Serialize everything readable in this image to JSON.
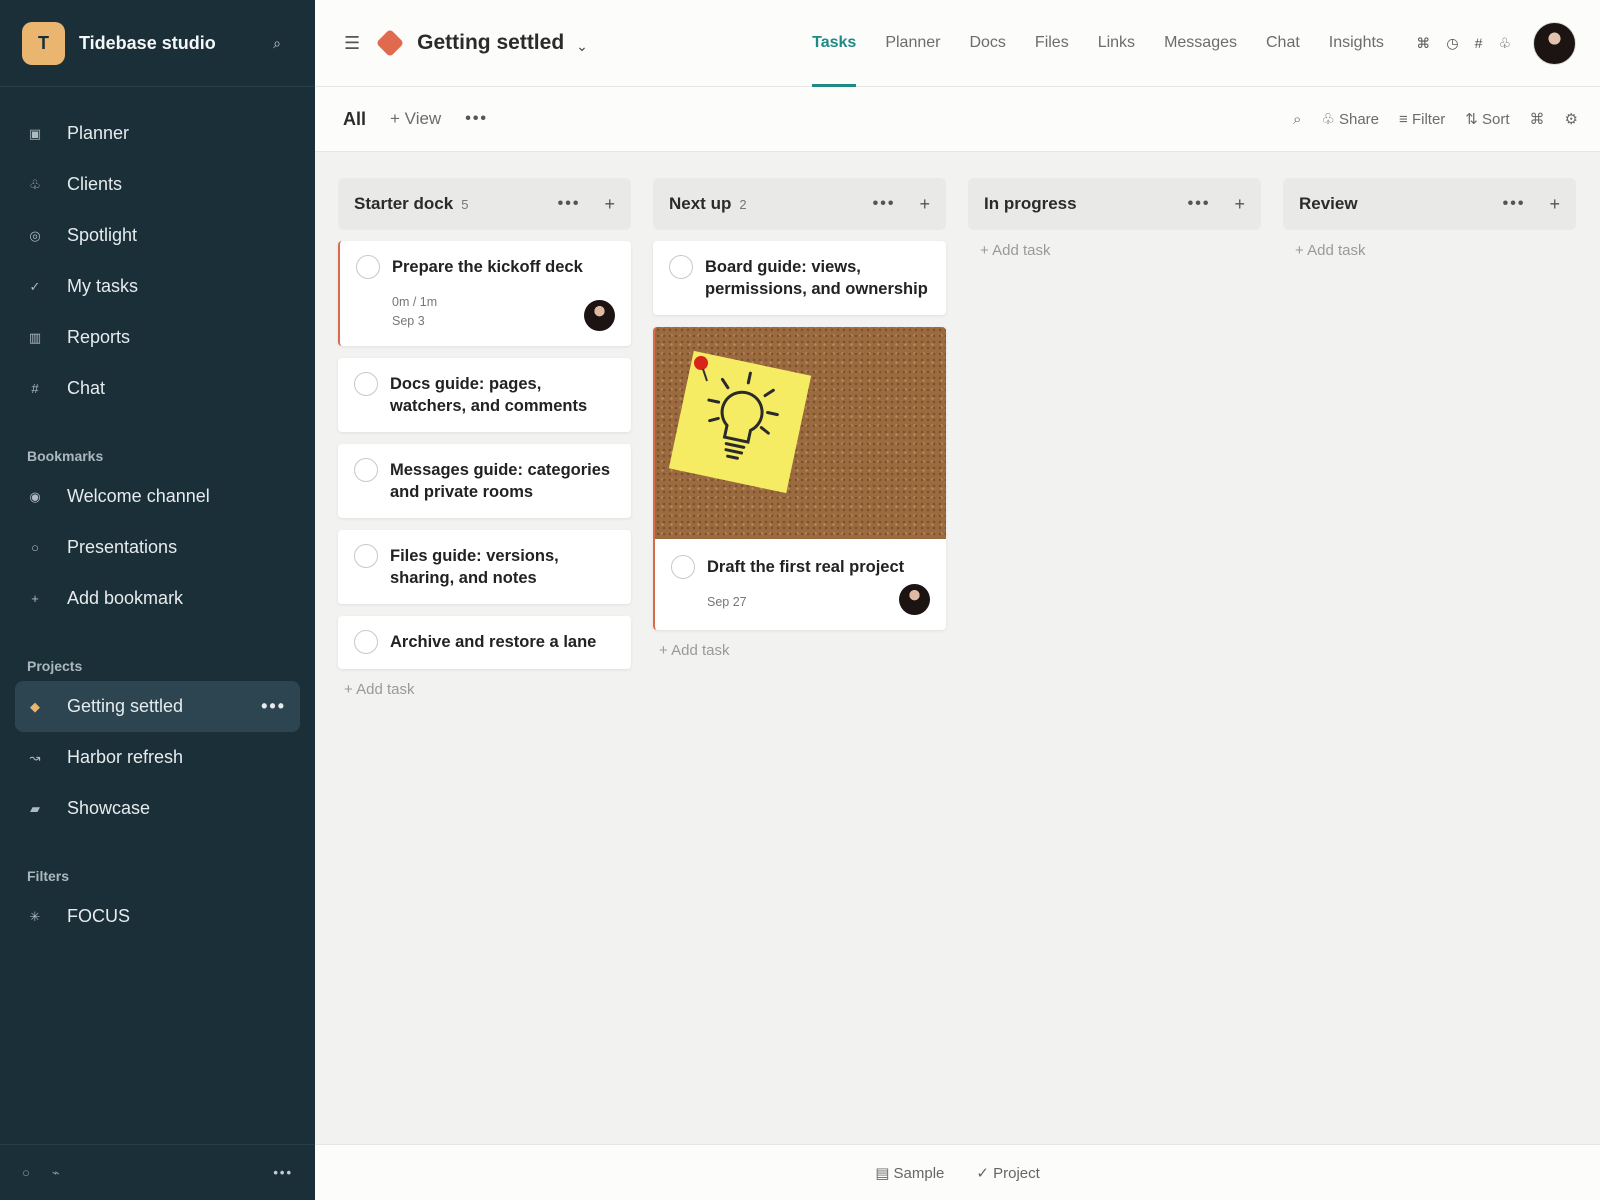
{
  "workspace": {
    "initial": "T",
    "name": "Tidebase studio"
  },
  "sidebar": {
    "nav": [
      {
        "label": "Planner",
        "icon": "planner-icon",
        "glyph": "▣"
      },
      {
        "label": "Clients",
        "icon": "clients-icon",
        "glyph": "♧"
      },
      {
        "label": "Spotlight",
        "icon": "spotlight-icon",
        "glyph": "◎"
      },
      {
        "label": "My tasks",
        "icon": "check-icon",
        "glyph": "✓"
      },
      {
        "label": "Reports",
        "icon": "reports-icon",
        "glyph": "▥"
      },
      {
        "label": "Chat",
        "icon": "hash-icon",
        "glyph": "#"
      }
    ],
    "bookmarks_label": "Bookmarks",
    "bookmarks": [
      {
        "label": "Welcome channel",
        "icon": "channel-icon",
        "glyph": "◉"
      },
      {
        "label": "Presentations",
        "icon": "presentation-icon",
        "glyph": "○"
      },
      {
        "label": "Add bookmark",
        "icon": "plus-icon",
        "glyph": "+"
      }
    ],
    "projects_label": "Projects",
    "projects": [
      {
        "label": "Getting settled",
        "icon": "diamond-icon",
        "glyph": "◆",
        "active": true
      },
      {
        "label": "Harbor refresh",
        "icon": "wave-icon",
        "glyph": "↝"
      },
      {
        "label": "Showcase",
        "icon": "showcase-icon",
        "glyph": "▰"
      }
    ],
    "filters_label": "Filters",
    "filters": [
      {
        "label": "FOCUS",
        "icon": "asterisk-icon",
        "glyph": "✳"
      }
    ]
  },
  "header": {
    "project_title": "Getting settled",
    "tabs": [
      "Tasks",
      "Planner",
      "Docs",
      "Files",
      "Links",
      "Messages",
      "Chat",
      "Insights"
    ],
    "active_tab": "Tasks"
  },
  "toolbar": {
    "all_label": "All",
    "view_label": "+ View",
    "share_label": "♧ Share",
    "filter_label": "≡ Filter",
    "sort_label": "⇅ Sort"
  },
  "columns": [
    {
      "title": "Starter dock",
      "count": "5",
      "cards": [
        {
          "title": "Prepare the kickoff deck",
          "meta1": "0m / 1m",
          "meta2": "Sep 3",
          "avatar": true,
          "accent": true
        },
        {
          "title": "Docs guide: pages, watchers, and comments"
        },
        {
          "title": "Messages guide: categories and private rooms"
        },
        {
          "title": "Files guide: versions, sharing, and notes"
        },
        {
          "title": "Archive and restore a lane"
        }
      ]
    },
    {
      "title": "Next up",
      "count": "2",
      "cards": [
        {
          "title": "Board guide: views, permissions, and ownership"
        },
        {
          "title": "Draft the first real project",
          "meta2": "Sep 27",
          "avatar": true,
          "image": true,
          "accent": true
        }
      ]
    },
    {
      "title": "In progress",
      "count": "",
      "cards": []
    },
    {
      "title": "Review",
      "count": "",
      "cards": []
    }
  ],
  "add_task_label": "+ Add task",
  "bottombar": {
    "sample_label": "▤ Sample",
    "project_label": "✓ Project"
  },
  "colors": {
    "sidebar": "#1b2f38",
    "accent": "#1f8a84",
    "project": "#e06a4d",
    "workspace": "#e9b56f"
  }
}
